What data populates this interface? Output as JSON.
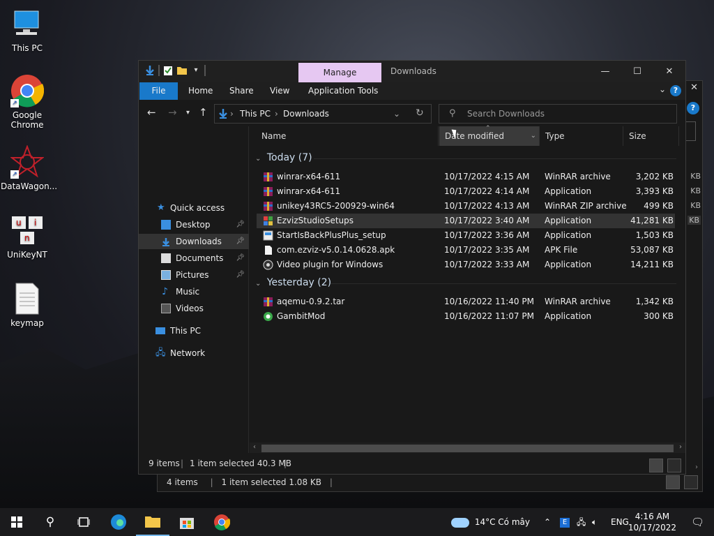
{
  "desktop": {
    "icons": [
      {
        "label": "This PC"
      },
      {
        "label": "Google\nChrome"
      },
      {
        "label": "DataWagon..."
      },
      {
        "label": "UniKeyNT"
      },
      {
        "label": "keymap"
      }
    ]
  },
  "back_window": {
    "status_items": "4 items",
    "status_selected": "1 item selected  1.08 KB",
    "strip_labels": [
      "KB",
      "KB",
      "KB",
      "KB"
    ]
  },
  "window": {
    "manage_tab": "Manage",
    "title": "Downloads",
    "ribbon_tabs": [
      "File",
      "Home",
      "Share",
      "View",
      "Application Tools"
    ],
    "help": "?",
    "breadcrumb": [
      "This PC",
      "Downloads"
    ],
    "search_placeholder": "Search Downloads",
    "nav": {
      "quick_access": "Quick access",
      "desktop": "Desktop",
      "downloads": "Downloads",
      "documents": "Documents",
      "pictures": "Pictures",
      "music": "Music",
      "videos": "Videos",
      "this_pc": "This PC",
      "network": "Network"
    },
    "columns": {
      "name": "Name",
      "date": "Date modified",
      "type": "Type",
      "size": "Size"
    },
    "groups": [
      {
        "label": "Today (7)",
        "files": [
          {
            "name": "winrar-x64-611",
            "date": "10/17/2022 4:15 AM",
            "type": "WinRAR archive",
            "size": "3,202 KB",
            "icon": "winrar-icon"
          },
          {
            "name": "winrar-x64-611",
            "date": "10/17/2022 4:14 AM",
            "type": "Application",
            "size": "3,393 KB",
            "icon": "winrar-icon"
          },
          {
            "name": "unikey43RC5-200929-win64",
            "date": "10/17/2022 4:13 AM",
            "type": "WinRAR ZIP archive",
            "size": "499 KB",
            "icon": "winrar-icon"
          },
          {
            "name": "EzvizStudioSetups",
            "date": "10/17/2022 3:40 AM",
            "type": "Application",
            "size": "41,281 KB",
            "icon": "installer-icon"
          },
          {
            "name": "StartIsBackPlusPlus_setup",
            "date": "10/17/2022 3:36 AM",
            "type": "Application",
            "size": "1,503 KB",
            "icon": "setup-icon"
          },
          {
            "name": "com.ezviz-v5.0.14.0628.apk",
            "date": "10/17/2022 3:35 AM",
            "type": "APK File",
            "size": "53,087 KB",
            "icon": "file-icon"
          },
          {
            "name": "Video plugin for Windows",
            "date": "10/17/2022 3:33 AM",
            "type": "Application",
            "size": "14,211 KB",
            "icon": "plugin-icon"
          }
        ]
      },
      {
        "label": "Yesterday (2)",
        "files": [
          {
            "name": "aqemu-0.9.2.tar",
            "date": "10/16/2022 11:40 PM",
            "type": "WinRAR archive",
            "size": "1,342 KB",
            "icon": "winrar-icon"
          },
          {
            "name": "GambitMod",
            "date": "10/16/2022 11:07 PM",
            "type": "Application",
            "size": "300 KB",
            "icon": "gambit-icon"
          }
        ]
      }
    ],
    "status_items": "9 items",
    "status_selected": "1 item selected  40.3 MB"
  },
  "taskbar": {
    "weather": "14°C  Có mây",
    "lang": "ENG",
    "time": "4:16 AM",
    "date": "10/17/2022"
  },
  "colors": {
    "accent": "#1979ca",
    "manage_tab": "#e6c8f2",
    "window_bg": "#191919",
    "selection": "#333333"
  }
}
